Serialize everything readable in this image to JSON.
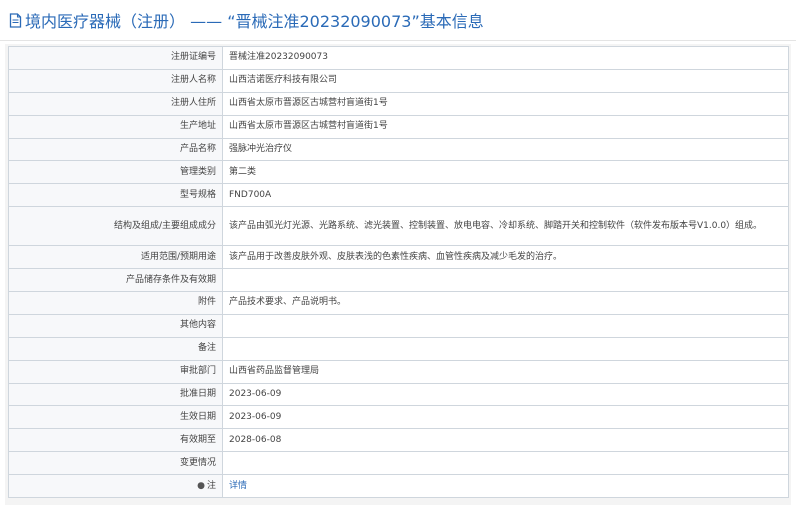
{
  "header": {
    "category": "境内医疗器械（注册）",
    "dash": " —— ",
    "record_title": "“晋械注准20232090073”基本信息"
  },
  "rows": [
    {
      "label": "注册证编号",
      "value": "晋械注准20232090073"
    },
    {
      "label": "注册人名称",
      "value": "山西洁诺医疗科技有限公司"
    },
    {
      "label": "注册人住所",
      "value": "山西省太原市晋源区古城营村盲道街1号"
    },
    {
      "label": "生产地址",
      "value": "山西省太原市晋源区古城营村盲道街1号"
    },
    {
      "label": "产品名称",
      "value": "强脉冲光治疗仪"
    },
    {
      "label": "管理类别",
      "value": "第二类"
    },
    {
      "label": "型号规格",
      "value": "FND700A"
    },
    {
      "label": "结构及组成/主要组成成分",
      "value": "该产品由弧光灯光源、光路系统、滤光装置、控制装置、放电电容、冷却系统、脚踏开关和控制软件（软件发布版本号V1.0.0）组成。"
    },
    {
      "label": "适用范围/预期用途",
      "value": "该产品用于改善皮肤外观、皮肤表浅的色素性疾病、血管性疾病及减少毛发的治疗。"
    },
    {
      "label": "产品储存条件及有效期",
      "value": ""
    },
    {
      "label": "附件",
      "value": "产品技术要求、产品说明书。"
    },
    {
      "label": "其他内容",
      "value": ""
    },
    {
      "label": "备注",
      "value": ""
    },
    {
      "label": "审批部门",
      "value": "山西省药品监督管理局"
    },
    {
      "label": "批准日期",
      "value": "2023-06-09"
    },
    {
      "label": "生效日期",
      "value": "2023-06-09"
    },
    {
      "label": "有效期至",
      "value": "2028-06-08"
    },
    {
      "label": "变更情况",
      "value": ""
    },
    {
      "label": "注",
      "value": "详情"
    }
  ],
  "icons": {
    "header": "document-icon",
    "note": "pin-icon"
  },
  "colors": {
    "title": "#2a6ab7",
    "link": "#2a6ab7",
    "border": "#cfd6dd",
    "label_bg": "#f7f8fa"
  }
}
